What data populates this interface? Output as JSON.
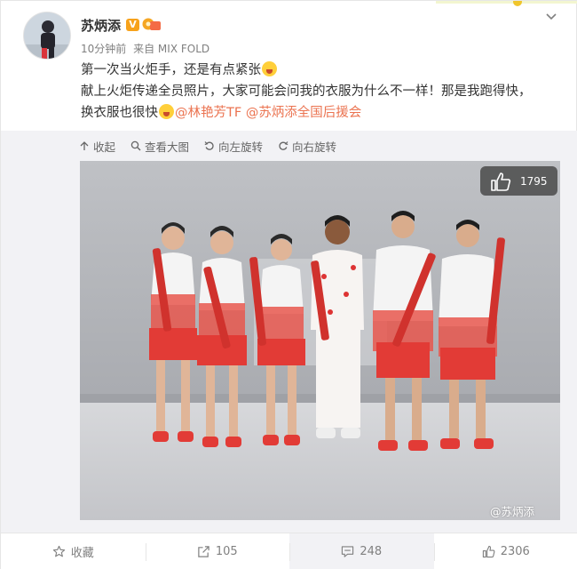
{
  "post": {
    "author": "苏炳添",
    "verified_badge": "V",
    "time": "10分钟前",
    "source": "来自 MIX FOLD",
    "lines": [
      "第一次当火炬手，还是有点紧张",
      "献上火炬传递全员照片，大家可能会问我的衣服为什么不一样！那是我跑得快，",
      "换衣服也很快"
    ],
    "mentions": [
      "@林艳芳TF",
      "@苏炳添全国后援会"
    ]
  },
  "media_toolbar": {
    "collapse": "收起",
    "view_large": "查看大图",
    "rotate_left": "向左旋转",
    "rotate_right": "向右旋转"
  },
  "photo": {
    "like_count": "1795",
    "watermark": "@苏炳添"
  },
  "footer": {
    "favorite": "收藏",
    "reposts": "105",
    "comments": "248",
    "likes": "2306"
  },
  "colors": {
    "mention": "#eb7350",
    "badge": "#f7a21b",
    "jersey_red": "#e23b36"
  },
  "icons": [
    "chevron-down-icon",
    "collapse-icon",
    "search-icon",
    "rotate-left-icon",
    "rotate-right-icon",
    "thumb-up-icon",
    "star-icon",
    "repost-icon",
    "comment-icon",
    "like-icon"
  ]
}
